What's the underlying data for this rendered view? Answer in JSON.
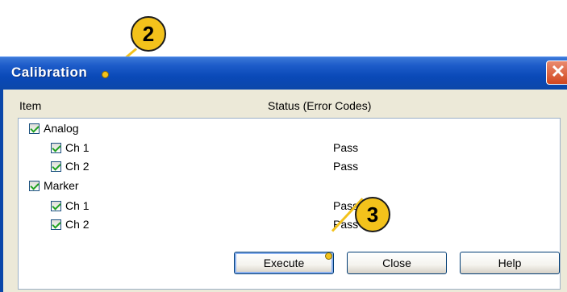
{
  "dialog": {
    "title": "Calibration",
    "close_symbol": "✕",
    "columns": {
      "item": "Item",
      "status": "Status (Error Codes)"
    },
    "tree": [
      {
        "label": "Analog",
        "checked": true,
        "level": 0,
        "status": ""
      },
      {
        "label": "Ch 1",
        "checked": true,
        "level": 1,
        "status": "Pass"
      },
      {
        "label": "Ch 2",
        "checked": true,
        "level": 1,
        "status": "Pass"
      },
      {
        "label": "Marker",
        "checked": true,
        "level": 0,
        "status": ""
      },
      {
        "label": "Ch 1",
        "checked": true,
        "level": 1,
        "status": "Pass"
      },
      {
        "label": "Ch 2",
        "checked": true,
        "level": 1,
        "status": "Pass"
      }
    ],
    "buttons": {
      "execute": "Execute",
      "close": "Close",
      "help": "Help"
    }
  },
  "callouts": {
    "step_title": "2",
    "step_execute": "3"
  },
  "colors": {
    "titlebar": "#0b47a9",
    "callout": "#f3c21b",
    "checkmark": "#21a121"
  }
}
